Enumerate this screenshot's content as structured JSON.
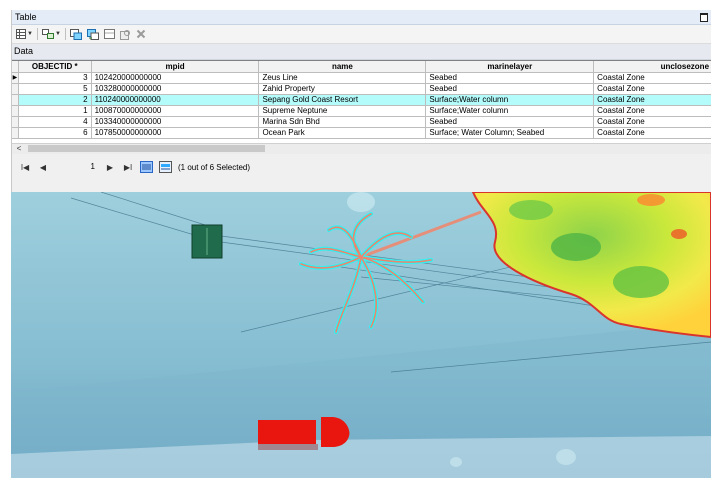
{
  "window": {
    "title": "Table"
  },
  "toolbar": {
    "icons": [
      "table-options-icon",
      "related-tables-icon",
      "select-by-attributes-icon",
      "switch-selection-icon",
      "clear-selection-icon",
      "zoom-to-selected-icon",
      "delete-selected-icon"
    ]
  },
  "tab": {
    "label": "Data"
  },
  "grid": {
    "columns": [
      "OBJECTID *",
      "mpid",
      "name",
      "marinelayer",
      "unclosezone"
    ],
    "rows": [
      {
        "objectid": "3",
        "mpid": "102420000000000",
        "name": "Zeus Line",
        "marinelayer": "Seabed",
        "unclos": "Coastal Zone",
        "current": true,
        "selected": false
      },
      {
        "objectid": "5",
        "mpid": "103280000000000",
        "name": "Zahid Property",
        "marinelayer": "Seabed",
        "unclos": "Coastal Zone",
        "current": false,
        "selected": false
      },
      {
        "objectid": "2",
        "mpid": "110240000000000",
        "name": "Sepang Gold Coast Resort",
        "marinelayer": "Surface;Water column",
        "unclos": "Coastal Zone",
        "current": false,
        "selected": true
      },
      {
        "objectid": "1",
        "mpid": "100870000000000",
        "name": "Supreme Neptune",
        "marinelayer": "Surface;Water column",
        "unclos": "Coastal Zone",
        "current": false,
        "selected": false
      },
      {
        "objectid": "4",
        "mpid": "103340000000000",
        "name": "Marina Sdn Bhd",
        "marinelayer": "Seabed",
        "unclos": "Coastal Zone",
        "current": false,
        "selected": false
      },
      {
        "objectid": "6",
        "mpid": "107850000000000",
        "name": "Ocean Park",
        "marinelayer": "Surface; Water Column; Seabed",
        "unclos": "Coastal Zone",
        "current": false,
        "selected": false
      }
    ]
  },
  "navigation": {
    "record": "1",
    "status": "(1 out of 6 Selected)"
  },
  "colors": {
    "selected_row": "#b4fbfb",
    "water": "#8cc3d6",
    "selection_highlight": "#2ff3f3",
    "land_outline": "#d9352c",
    "feature_red": "#e8160f",
    "feature_green": "#1f6b4b"
  }
}
